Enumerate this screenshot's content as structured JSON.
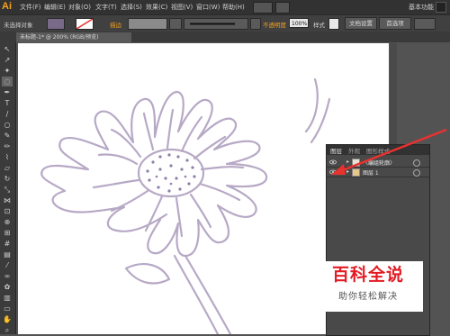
{
  "app": {
    "logo": "Ai",
    "workspace": "基本功能"
  },
  "menu": [
    "文件(F)",
    "编辑(E)",
    "对象(O)",
    "文字(T)",
    "选择(S)",
    "效果(C)",
    "视图(V)",
    "窗口(W)",
    "帮助(H)"
  ],
  "control_bar": {
    "selection": "未选择对象",
    "stroke_label": "描边",
    "opacity_label": "不透明度",
    "opacity_value": "100%",
    "style_label": "样式",
    "doc_setup": "文档设置",
    "preferences": "首选项"
  },
  "document": {
    "tab_title": "未标题-1* @ 200% (RGB/预览)"
  },
  "layers_panel": {
    "tabs": [
      "图层",
      "外观",
      "图形样式"
    ],
    "rows": [
      {
        "name": "〈编组轮廓〉"
      },
      {
        "name": "图层 1"
      }
    ]
  },
  "watermark": {
    "title": "百科全说",
    "subtitle": "助你轻松解决"
  },
  "colors": {
    "accent": "#f7a11a",
    "stroke": "#b7a9c6",
    "arrow": "#e8322f",
    "watermark_red": "#e31b23"
  }
}
